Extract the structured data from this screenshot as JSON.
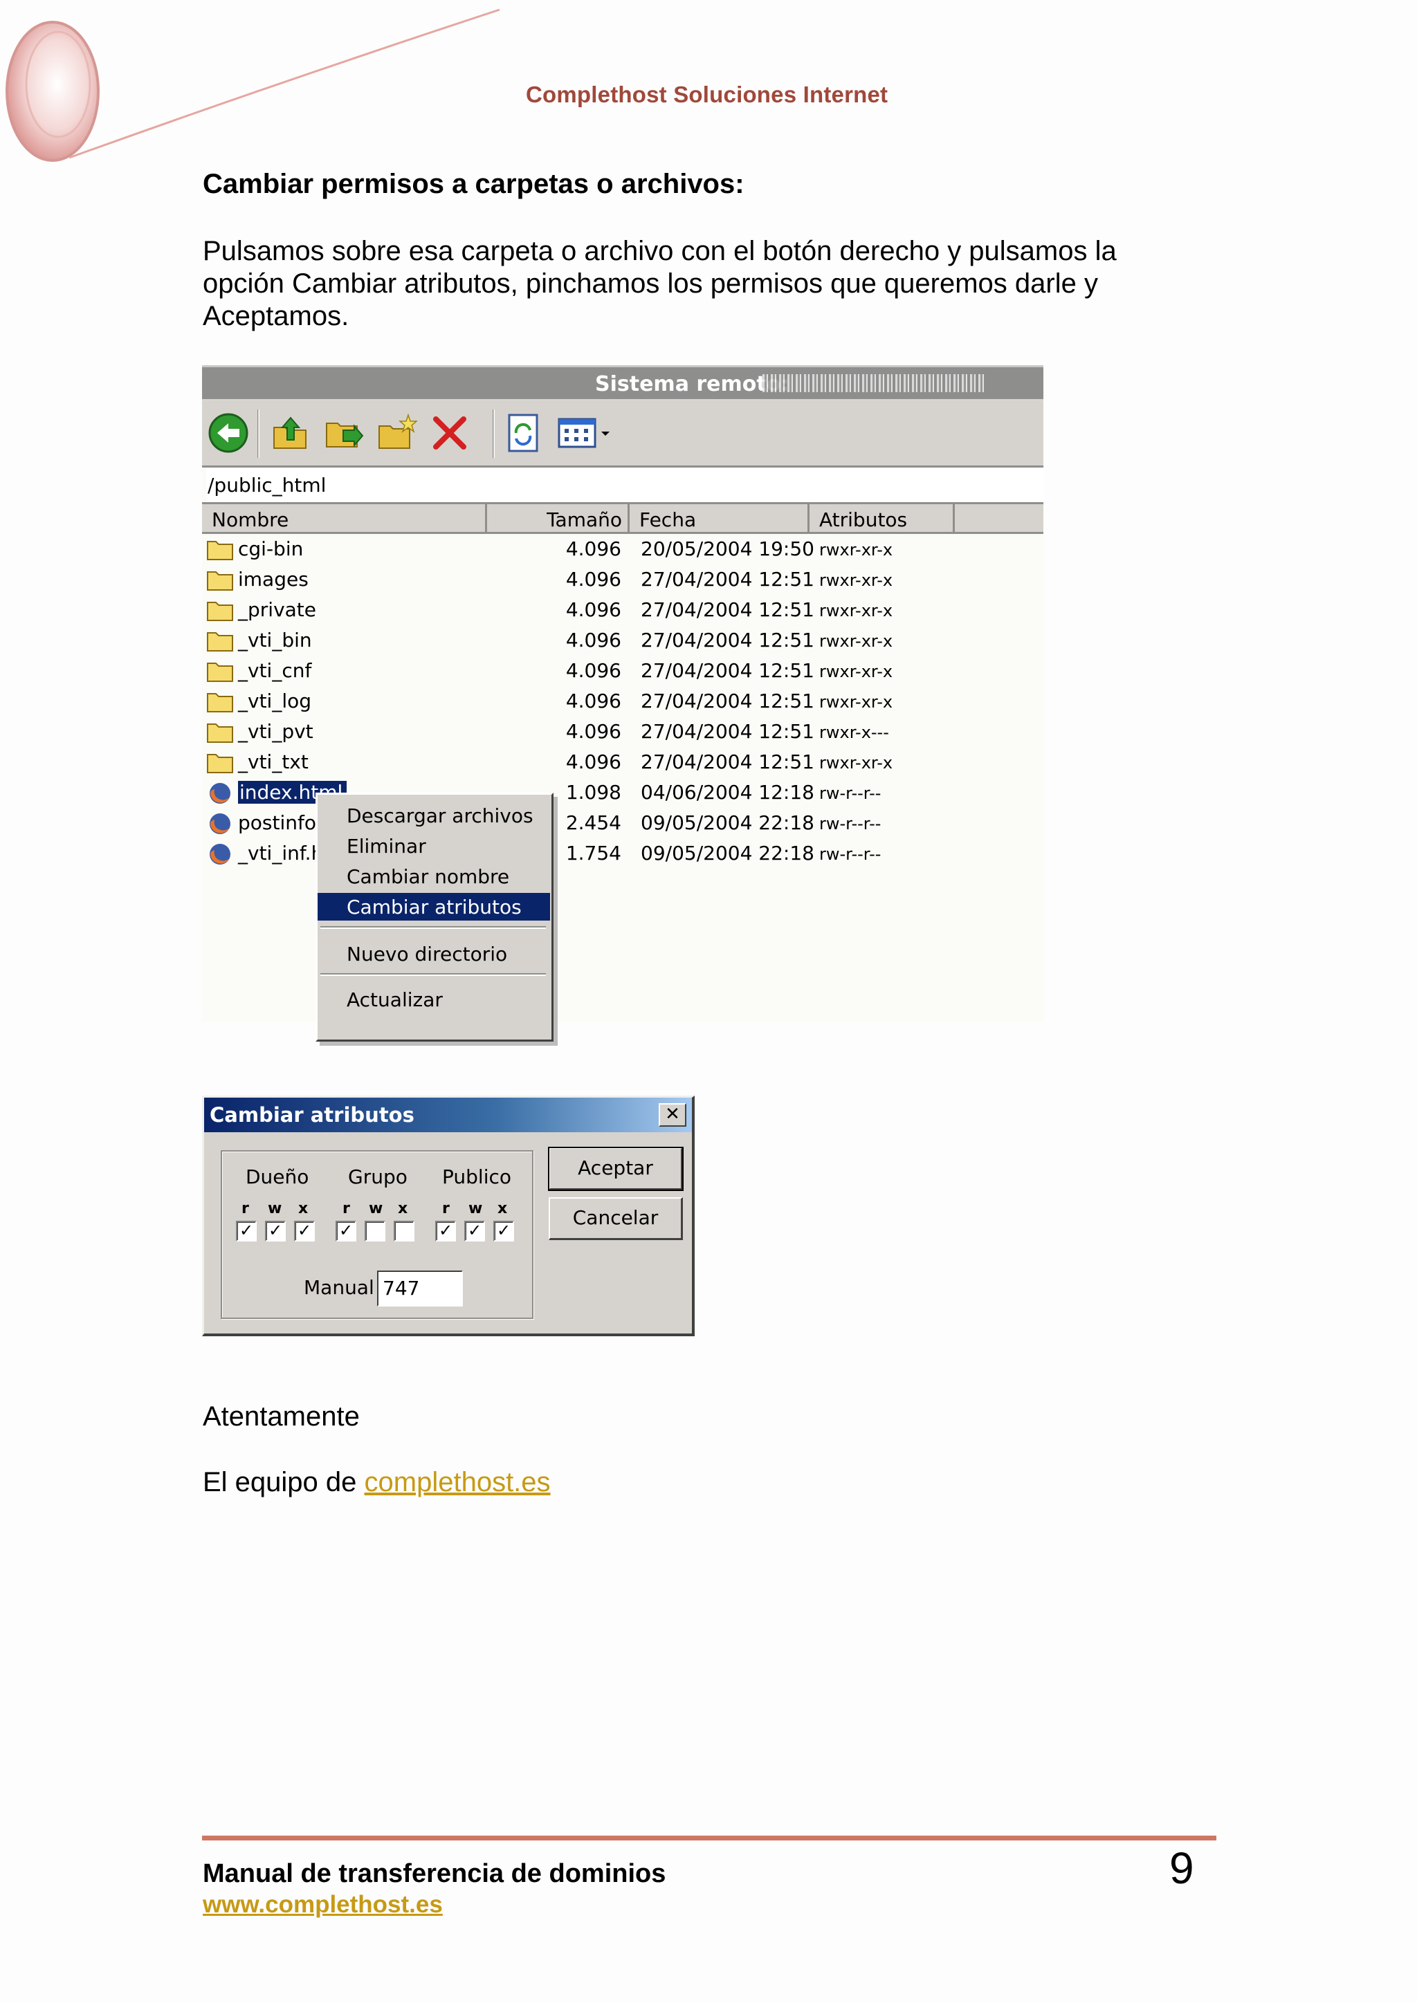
{
  "header": {
    "company": "Complethost Soluciones Internet"
  },
  "section": {
    "heading": "Cambiar permisos a carpetas o archivos:",
    "intro": "Pulsamos sobre esa carpeta o archivo con el botón derecho y pulsamos la opción Cambiar atributos, pinchamos los permisos que queremos darle y Aceptamos."
  },
  "ftp": {
    "title": "Sistema remoto:",
    "path": "/public_html",
    "columns": {
      "nombre": "Nombre",
      "tamano": "Tamaño",
      "fecha": "Fecha",
      "atributos": "Atributos"
    },
    "toolbar_icons": [
      "back-arrow-icon",
      "folder-up-icon",
      "folder-move-icon",
      "new-folder-icon",
      "delete-x-icon",
      "refresh-icon",
      "view-grid-icon",
      "dropdown-arrow-icon"
    ],
    "rows": [
      {
        "name": "cgi-bin",
        "type": "folder",
        "size": "4.096",
        "date": "20/05/2004 19:50",
        "attr": "rwxr-xr-x"
      },
      {
        "name": "images",
        "type": "folder",
        "size": "4.096",
        "date": "27/04/2004 12:51",
        "attr": "rwxr-xr-x"
      },
      {
        "name": "_private",
        "type": "folder",
        "size": "4.096",
        "date": "27/04/2004 12:51",
        "attr": "rwxr-xr-x"
      },
      {
        "name": "_vti_bin",
        "type": "folder",
        "size": "4.096",
        "date": "27/04/2004 12:51",
        "attr": "rwxr-xr-x"
      },
      {
        "name": "_vti_cnf",
        "type": "folder",
        "size": "4.096",
        "date": "27/04/2004 12:51",
        "attr": "rwxr-xr-x"
      },
      {
        "name": "_vti_log",
        "type": "folder",
        "size": "4.096",
        "date": "27/04/2004 12:51",
        "attr": "rwxr-xr-x"
      },
      {
        "name": "_vti_pvt",
        "type": "folder",
        "size": "4.096",
        "date": "27/04/2004 12:51",
        "attr": "rwxr-x---"
      },
      {
        "name": "_vti_txt",
        "type": "folder",
        "size": "4.096",
        "date": "27/04/2004 12:51",
        "attr": "rwxr-xr-x"
      },
      {
        "name": "index.html",
        "type": "file",
        "size": "1.098",
        "date": "04/06/2004 12:18",
        "attr": "rw-r--r--"
      },
      {
        "name": "postinfo.html",
        "type": "file",
        "size": "2.454",
        "date": "09/05/2004 22:18",
        "attr": "rw-r--r--"
      },
      {
        "name": "_vti_inf.html",
        "type": "file",
        "size": "1.754",
        "date": "09/05/2004 22:18",
        "attr": "rw-r--r--"
      }
    ],
    "context_menu": {
      "items": [
        "Descargar archivos",
        "Eliminar",
        "Cambiar nombre",
        "Cambiar atributos",
        "Nuevo directorio",
        "Actualizar"
      ],
      "highlighted": "Cambiar atributos"
    }
  },
  "dialog": {
    "title": "Cambiar atributos",
    "close_label": "✕",
    "groups": [
      {
        "label": "Dueño",
        "r": true,
        "w": true,
        "x": true
      },
      {
        "label": "Grupo",
        "r": true,
        "w": false,
        "x": false
      },
      {
        "label": "Publico",
        "r": true,
        "w": true,
        "x": true
      }
    ],
    "letters": {
      "r": "r",
      "w": "w",
      "x": "x"
    },
    "manual_label": "Manual",
    "manual_value": "747",
    "accept_label": "Aceptar",
    "cancel_label": "Cancelar"
  },
  "closing": {
    "greeting": "Atentamente",
    "signature_prefix": "El equipo de ",
    "signature_link": "complethost.es"
  },
  "footer": {
    "title": "Manual de transferencia de dominios",
    "link": "www.complethost.es",
    "page_number": "9"
  },
  "colors": {
    "header_text": "#a0483a",
    "link": "#c79a14",
    "footer_rule": "#cd7763",
    "selection": "#0a246a"
  }
}
